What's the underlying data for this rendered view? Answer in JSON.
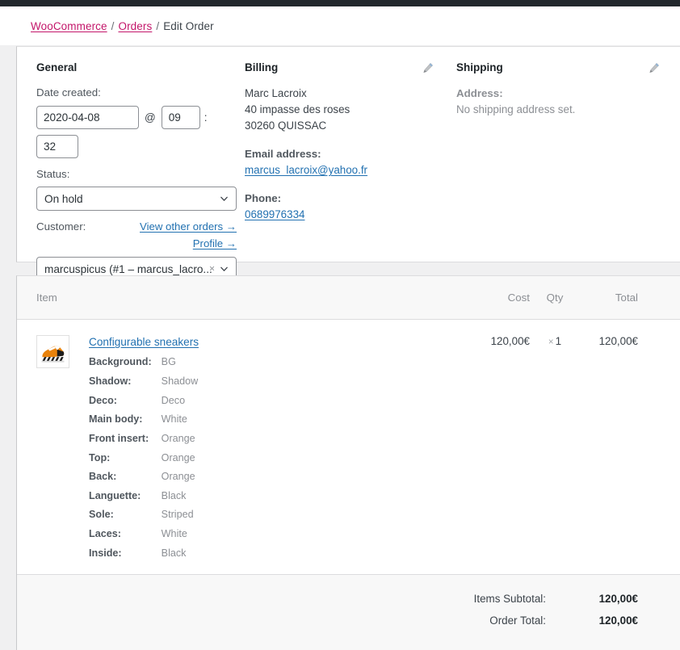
{
  "breadcrumb": {
    "items": [
      {
        "label": "WooCommerce",
        "link": true
      },
      {
        "label": "Orders",
        "link": true
      },
      {
        "label": "Edit Order",
        "link": false
      }
    ],
    "separator": "/"
  },
  "colors": {
    "breadcrumb_link": "#c3166a",
    "link_blue": "#2271b1",
    "text_dark": "#1d2327",
    "text_muted": "#8c8f94",
    "panel_bg": "#ffffff",
    "page_bg": "#f0f0f1",
    "header_row_bg": "#f8f8f8",
    "adminbar": "#23282d"
  },
  "order_data": {
    "general": {
      "title": "General",
      "date_label": "Date created:",
      "date_value": "2020-04-08",
      "at_symbol": "@",
      "hour_value": "09",
      "colon_symbol": ":",
      "minute_value": "32",
      "status_label": "Status:",
      "status_value": "On hold",
      "customer_label": "Customer:",
      "view_other_orders": "View other orders →",
      "profile_link": "Profile →",
      "customer_value": "marcuspicus (#1 – marcus_lacro...",
      "clear_symbol": "×"
    },
    "billing": {
      "title": "Billing",
      "edit_icon": "pencil-icon",
      "name": "Marc Lacroix",
      "street": "40 impasse des roses",
      "city": "30260 QUISSAC",
      "email_label": "Email address:",
      "email_value": "marcus_lacroix@yahoo.fr",
      "phone_label": "Phone:",
      "phone_value": "0689976334"
    },
    "shipping": {
      "title": "Shipping",
      "edit_icon": "pencil-icon",
      "address_label": "Address:",
      "address_value": "No shipping address set."
    }
  },
  "items": {
    "columns": {
      "item": "Item",
      "cost": "Cost",
      "qty": "Qty",
      "total": "Total"
    },
    "rows": [
      {
        "thumbnail": "sneaker-thumbnail",
        "name": "Configurable sneakers",
        "cost": "120,00€",
        "qty_prefix": "×",
        "qty": "1",
        "total": "120,00€",
        "attributes": [
          {
            "key": "Background:",
            "value": "BG"
          },
          {
            "key": "Shadow:",
            "value": "Shadow"
          },
          {
            "key": "Deco:",
            "value": "Deco"
          },
          {
            "key": "Main body:",
            "value": "White"
          },
          {
            "key": "Front insert:",
            "value": "Orange"
          },
          {
            "key": "Top:",
            "value": "Orange"
          },
          {
            "key": "Back:",
            "value": "Orange"
          },
          {
            "key": "Languette:",
            "value": "Black"
          },
          {
            "key": "Sole:",
            "value": "Striped"
          },
          {
            "key": "Laces:",
            "value": "White"
          },
          {
            "key": "Inside:",
            "value": "Black"
          }
        ]
      }
    ]
  },
  "totals": [
    {
      "label": "Items Subtotal:",
      "value": "120,00€"
    },
    {
      "label": "Order Total:",
      "value": "120,00€"
    }
  ]
}
